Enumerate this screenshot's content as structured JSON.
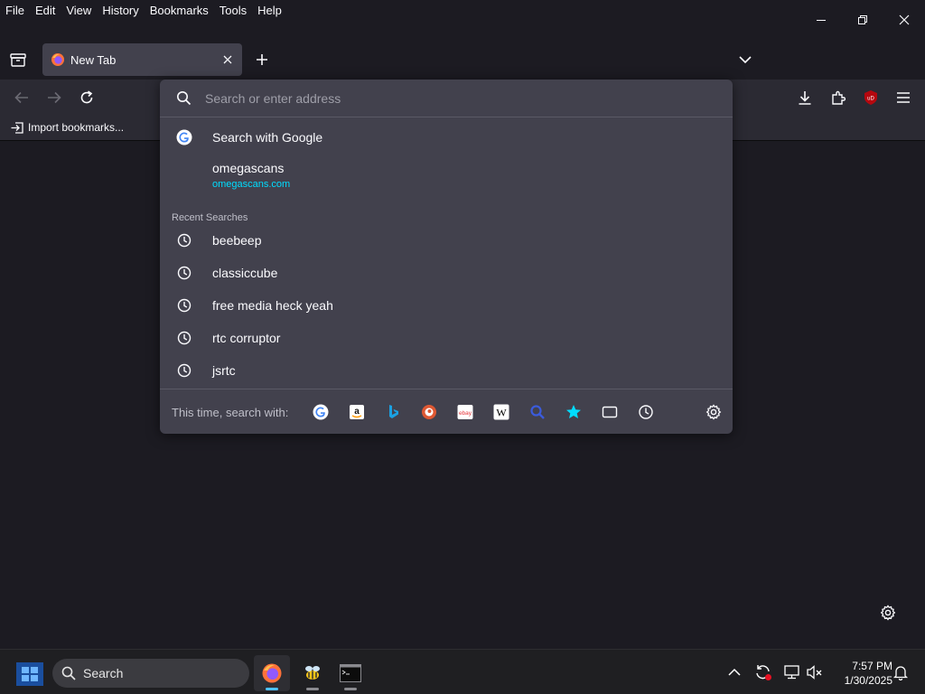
{
  "menu": [
    "File",
    "Edit",
    "View",
    "History",
    "Bookmarks",
    "Tools",
    "Help"
  ],
  "tab": {
    "title": "New Tab"
  },
  "bookmarks_toolbar": {
    "import_label": "Import bookmarks..."
  },
  "urlbar": {
    "placeholder": "Search or enter address",
    "results": {
      "search_with": "Search with Google",
      "site": {
        "title": "omegascans",
        "url": "omegascans.com"
      },
      "recent_label": "Recent Searches",
      "recent": [
        "beebeep",
        "classiccube",
        "free media heck yeah",
        "rtc corruptor",
        "jsrtc"
      ]
    },
    "one_off_label": "This time, search with:",
    "engines": [
      "google-icon",
      "amazon-icon",
      "bing-icon",
      "duckduckgo-icon",
      "ebay-icon",
      "wikipedia-icon",
      "search-plugin-icon",
      "bookmarks-icon",
      "tabs-icon",
      "history-icon"
    ]
  },
  "taskbar": {
    "search_label": "Search",
    "time": "7:57 PM",
    "date": "1/30/2025"
  },
  "colors": {
    "accent": "#00ddff",
    "popup_bg": "#42414d",
    "toolbar_bg": "#2b2a33",
    "content_bg": "#1c1b22",
    "ublock_red": "#b5080f"
  }
}
